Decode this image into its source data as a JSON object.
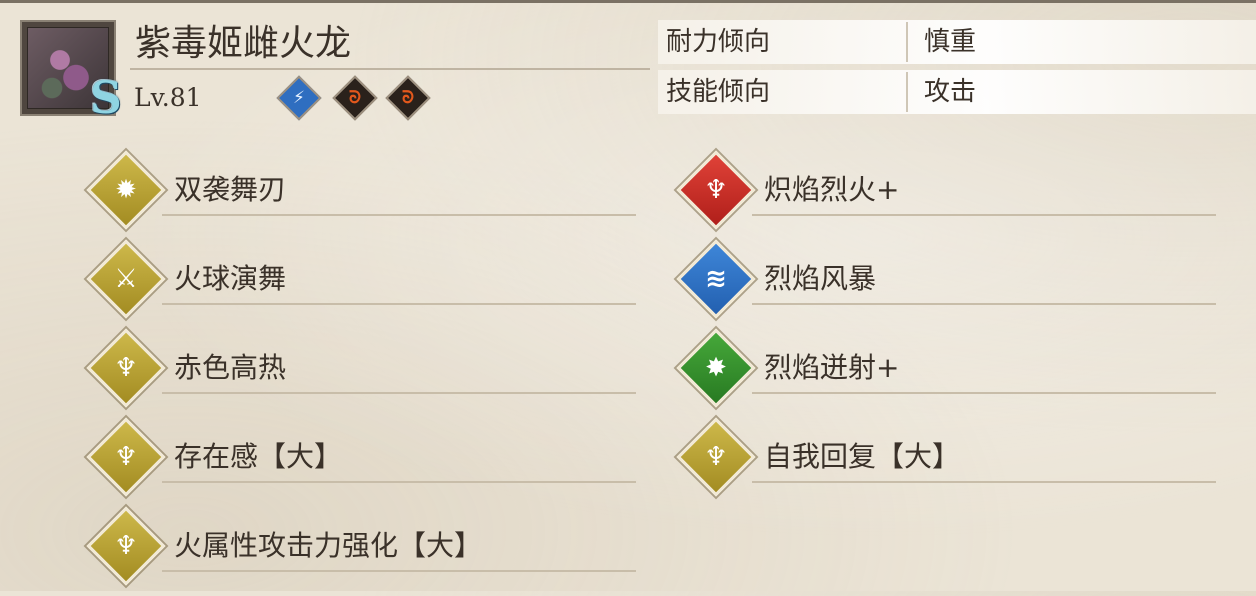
{
  "monster": {
    "name": "紫毒姬雌火龙",
    "rank": "S",
    "level": "Lv.81",
    "elements": [
      {
        "icon": "wind-element-icon",
        "glyph": "⚡"
      },
      {
        "icon": "fire-element-icon",
        "glyph": "ᘐ"
      },
      {
        "icon": "fire-element-icon",
        "glyph": "ᘐ"
      }
    ]
  },
  "tendencies": [
    {
      "label": "耐力倾向",
      "value": "慎重"
    },
    {
      "label": "技能倾向",
      "value": "攻击"
    }
  ],
  "skills_left": [
    {
      "name": "双袭舞刃",
      "icon": "sun-burst-icon",
      "glyph": "✹",
      "color": "gold"
    },
    {
      "name": "火球演舞",
      "icon": "claw-slash-icon",
      "glyph": "⚔",
      "color": "gold"
    },
    {
      "name": "赤色高热",
      "icon": "power-up-icon",
      "glyph": "♆",
      "color": "gold"
    },
    {
      "name": "存在感【大】",
      "icon": "power-up-icon",
      "glyph": "♆",
      "color": "gold"
    },
    {
      "name": "火属性攻击力强化【大】",
      "icon": "power-up-icon",
      "glyph": "♆",
      "color": "gold"
    }
  ],
  "skills_right": [
    {
      "name": "炽焰烈火+",
      "icon": "power-up-icon",
      "glyph": "♆",
      "color": "red"
    },
    {
      "name": "烈焰风暴",
      "icon": "dash-icon",
      "glyph": "≋",
      "color": "blue"
    },
    {
      "name": "烈焰迸射+",
      "icon": "burst-icon",
      "glyph": "✸",
      "color": "green"
    },
    {
      "name": "自我回复【大】",
      "icon": "power-up-icon",
      "glyph": "♆",
      "color": "gold"
    }
  ],
  "colors": {
    "gold": "#b8a236",
    "red": "#c8312a",
    "blue": "#2f72c6",
    "green": "#379130",
    "background": "#ebe4d6"
  }
}
